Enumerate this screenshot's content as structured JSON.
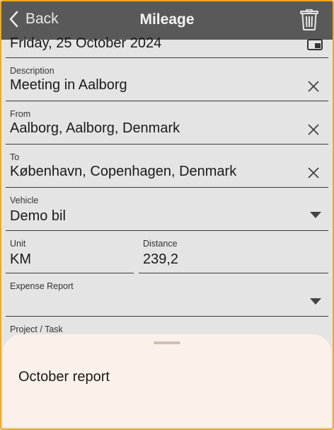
{
  "header": {
    "back_label": "Back",
    "title": "Mileage"
  },
  "date": {
    "value": "Friday, 25 October 2024"
  },
  "description": {
    "label": "Description",
    "value": "Meeting in Aalborg"
  },
  "from": {
    "label": "From",
    "value": "Aalborg, Aalborg, Denmark"
  },
  "to": {
    "label": "To",
    "value": "København, Copenhagen, Denmark"
  },
  "vehicle": {
    "label": "Vehicle",
    "value": "Demo bil"
  },
  "unit": {
    "label": "Unit",
    "value": "KM"
  },
  "distance": {
    "label": "Distance",
    "value": "239,2"
  },
  "expense_report": {
    "label": "Expense Report",
    "value": ""
  },
  "project_task": {
    "label": "Project / Task"
  },
  "sheet": {
    "options": [
      "October report"
    ]
  },
  "colors": {
    "header_bg": "#595959",
    "page_bg": "#e4e4e4",
    "sheet_bg": "#fcf1ea",
    "frame_border": "#f2a81d"
  }
}
